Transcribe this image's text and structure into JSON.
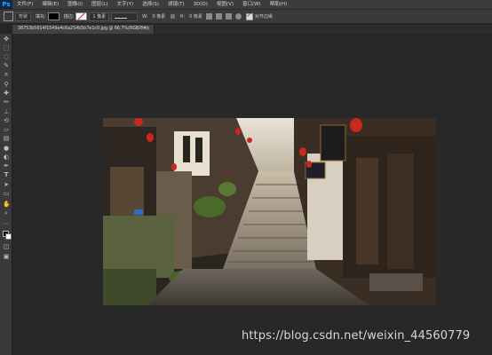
{
  "app": {
    "logo": "Ps"
  },
  "menu": [
    "文件(F)",
    "编辑(E)",
    "图像(I)",
    "图层(L)",
    "文字(Y)",
    "选择(S)",
    "滤镜(T)",
    "3D(D)",
    "视图(V)",
    "窗口(W)",
    "帮助(H)"
  ],
  "options": {
    "shape_mode": "形状",
    "fill_label": "填充:",
    "stroke_label": "描边:",
    "stroke_size": "1 像素",
    "w_label": "W:",
    "w_value": "0 像素",
    "h_label": "H:",
    "h_value": "0 像素",
    "align_edges": "对齐边缘"
  },
  "document": {
    "tab_title": "38753b5614f1549e4c6a254b5b7e1c0.jpg @ 66.7%(RGB/8#)",
    "close": "×"
  },
  "watermark": "https://blog.csdn.net/weixin_44560779",
  "colors": {
    "accent": "#31a8ff",
    "panel": "#3a3a3a",
    "canvas": "#282828"
  }
}
